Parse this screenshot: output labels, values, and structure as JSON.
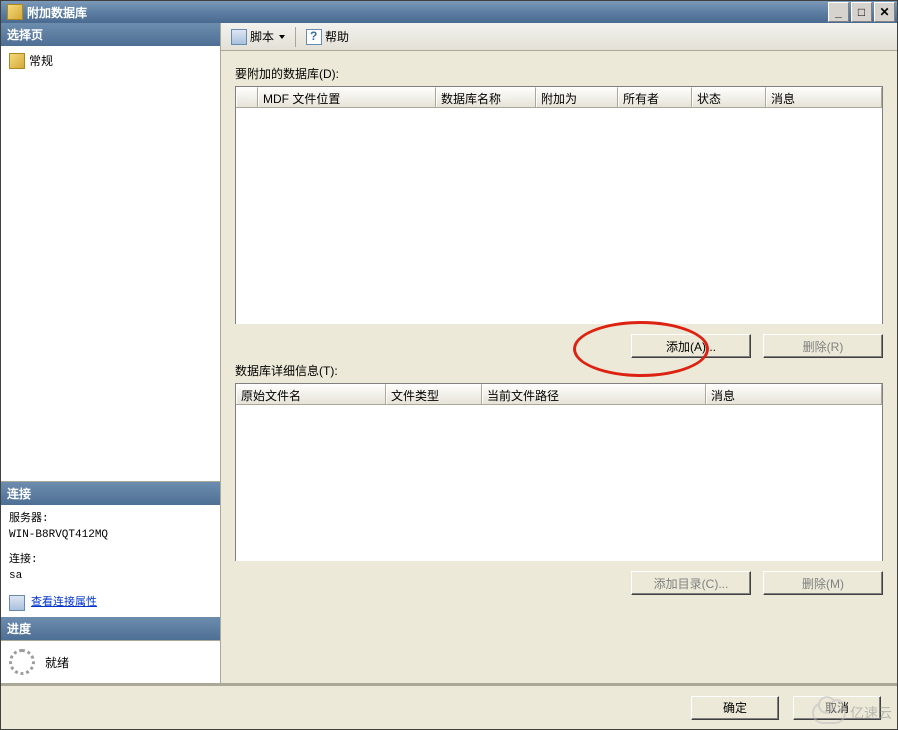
{
  "window": {
    "title": "附加数据库"
  },
  "sidebar": {
    "header_select": "选择页",
    "items": [
      {
        "label": "常规"
      }
    ],
    "header_conn": "连接",
    "server_label": "服务器:",
    "server_value": "WIN-B8RVQT412MQ",
    "conn_label": "连接:",
    "conn_value": "sa",
    "view_props": "查看连接属性",
    "header_prog": "进度",
    "status": "就绪"
  },
  "toolbar": {
    "script": "脚本",
    "help": "帮助"
  },
  "main": {
    "attach_label": "要附加的数据库(D):",
    "grid1_cols": {
      "c1": "",
      "c2": "MDF 文件位置",
      "c3": "数据库名称",
      "c4": "附加为",
      "c5": "所有者",
      "c6": "状态",
      "c7": "消息"
    },
    "add_btn": "添加(A)...",
    "remove_btn": "删除(R)",
    "details_label": "数据库详细信息(T):",
    "grid2_cols": {
      "c1": "原始文件名",
      "c2": "文件类型",
      "c3": "当前文件路径",
      "c4": "消息"
    },
    "add_dir_btn": "添加目录(C)...",
    "remove2_btn": "删除(M)"
  },
  "footer": {
    "ok": "确定",
    "cancel": "取消"
  },
  "watermark": "亿速云"
}
